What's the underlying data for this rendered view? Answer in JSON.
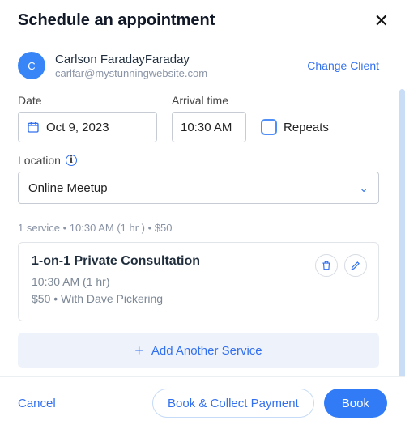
{
  "header": {
    "title": "Schedule an appointment"
  },
  "client": {
    "initial": "C",
    "name": "Carlson FaradayFaraday",
    "email": "carlfar@mystunningwebsite.com",
    "change_label": "Change Client"
  },
  "date": {
    "label": "Date",
    "value": "Oct 9, 2023"
  },
  "time": {
    "label": "Arrival time",
    "value": "10:30 AM"
  },
  "repeats": {
    "label": "Repeats"
  },
  "location": {
    "label": "Location",
    "value": "Online Meetup"
  },
  "summary": "1 service • 10:30 AM (1 hr ) • $50",
  "service": {
    "title": "1-on-1 Private Consultation",
    "line1": "10:30 AM  (1 hr)",
    "line2": "$50 • With Dave Pickering"
  },
  "add_service_label": "Add Another Service",
  "footer": {
    "cancel": "Cancel",
    "collect": "Book & Collect Payment",
    "book": "Book"
  }
}
